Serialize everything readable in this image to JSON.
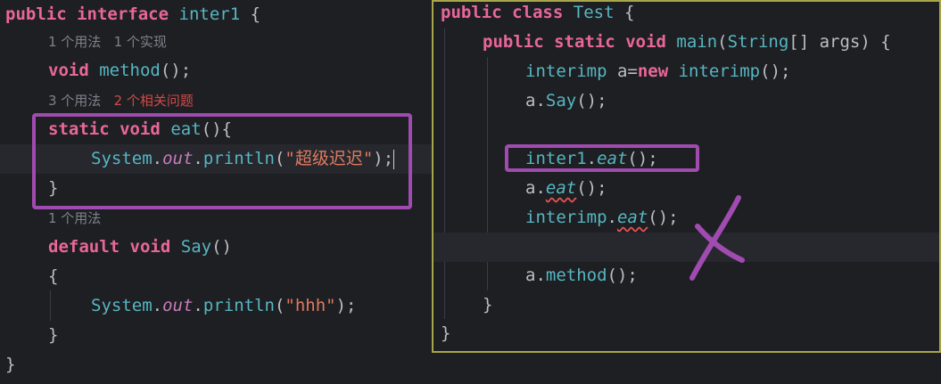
{
  "left": {
    "l1": {
      "kw1": "public",
      "kw2": "interface",
      "name": "inter1",
      "brace": " {"
    },
    "hint1": {
      "a": "1 个用法",
      "b": "1 个实现"
    },
    "l2": {
      "kw": "void",
      "fn": "method",
      "rest": "();"
    },
    "hint2": {
      "a": "3 个用法",
      "b": "2 个相关问题"
    },
    "l3": {
      "kw1": "static",
      "kw2": "void",
      "fn": "eat",
      "rest": "(){"
    },
    "l4": {
      "cls": "System",
      "dot1": ".",
      "fld": "out",
      "dot2": ".",
      "fn": "println",
      "p1": "(",
      "str": "\"超级迟迟\"",
      "p2": ");"
    },
    "l5": {
      "brace": "}"
    },
    "hint3": {
      "a": "1 个用法"
    },
    "l6": {
      "kw1": "default",
      "kw2": "void",
      "fn": "Say",
      "rest": "()"
    },
    "l7": {
      "brace": "{"
    },
    "l8": {
      "cls": "System",
      "dot1": ".",
      "fld": "out",
      "dot2": ".",
      "fn": "println",
      "p1": "(",
      "str": "\"hhh\"",
      "p2": ");"
    },
    "l9": {
      "brace": "}"
    },
    "l10": {
      "brace": "}"
    }
  },
  "right": {
    "l1": {
      "kw1": "public",
      "kw2": "class",
      "name": "Test",
      "brace": " {"
    },
    "l2": {
      "kw1": "public",
      "kw2": "static",
      "kw3": "void",
      "fn": "main",
      "p1": "(",
      "cls": "String",
      "rest": "[] args) {"
    },
    "l3": {
      "cls": "interimp",
      "a": " a=",
      "kw": "new",
      "cls2": " interimp",
      "rest": "();"
    },
    "l4": {
      "a": "a.",
      "fn": "Say",
      "rest": "();"
    },
    "l5": {
      "cls": "inter1",
      "dot": ".",
      "fn": "eat",
      "rest": "();"
    },
    "l6": {
      "a": "a.",
      "fn": "eat",
      "rest": "();"
    },
    "l7": {
      "cls": "interimp",
      "dot": ".",
      "fn": "eat",
      "rest": "();"
    },
    "l8": {
      "a": "a.",
      "fn": "method",
      "rest": "();"
    },
    "l9": {
      "brace": "}"
    },
    "l10": {
      "brace": "}"
    }
  },
  "colors": {
    "annotation": "#a04bb0",
    "keyword": "#e8679a",
    "type": "#56b6c2",
    "string": "#e07a5f"
  }
}
